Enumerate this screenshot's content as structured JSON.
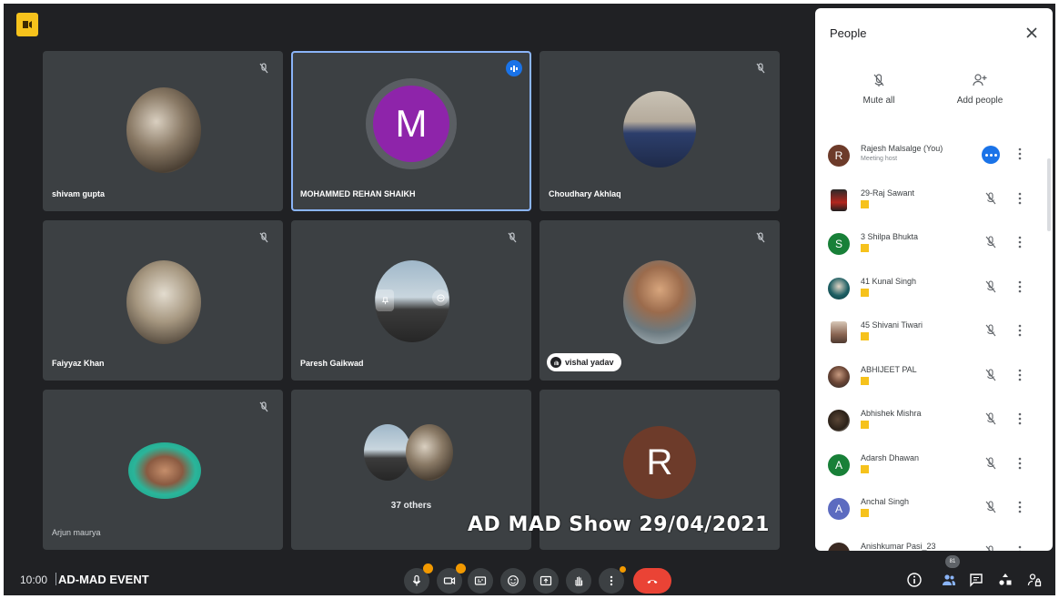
{
  "meeting": {
    "time": "10:00",
    "title": "AD-MAD EVENT",
    "watermark": "AD MAD Show 29/04/2021"
  },
  "tiles": [
    {
      "name": "shivam gupta"
    },
    {
      "name": "MOHAMMED REHAN SHAIKH",
      "avatar_letter": "M"
    },
    {
      "name": "Choudhary Akhlaq"
    },
    {
      "name": "Faiyyaz Khan"
    },
    {
      "name": "Paresh Gaikwad"
    },
    {
      "name": "vishal yadav"
    },
    {
      "name": "Arjun maurya"
    },
    {
      "others_label": "37 others"
    },
    {
      "avatar_letter": "R"
    }
  ],
  "people_panel": {
    "title": "People",
    "mute_all_label": "Mute all",
    "add_people_label": "Add people",
    "participants": [
      {
        "name": "Rajesh Malsalge (You)",
        "sub": "Meeting host",
        "avatar_letter": "R",
        "color": "#6d3b2a"
      },
      {
        "name": "29-Raj Sawant"
      },
      {
        "name": "3 Shilpa Bhukta",
        "avatar_letter": "S",
        "color": "#188038"
      },
      {
        "name": "41 Kunal Singh"
      },
      {
        "name": "45 Shivani Tiwari"
      },
      {
        "name": "ABHIJEET PAL"
      },
      {
        "name": "Abhishek Mishra"
      },
      {
        "name": "Adarsh Dhawan",
        "avatar_letter": "A",
        "color": "#188038"
      },
      {
        "name": "Anchal Singh",
        "avatar_letter": "A",
        "color": "#5c6bc0"
      },
      {
        "name": "Anishkumar Pasi_23"
      }
    ]
  },
  "bottom_bar": {
    "participant_count": "81"
  },
  "colors": {
    "background": "#202124",
    "tile": "#3c4043",
    "accent": "#1a73e8",
    "end_call": "#ea4335",
    "warning": "#f29900"
  }
}
